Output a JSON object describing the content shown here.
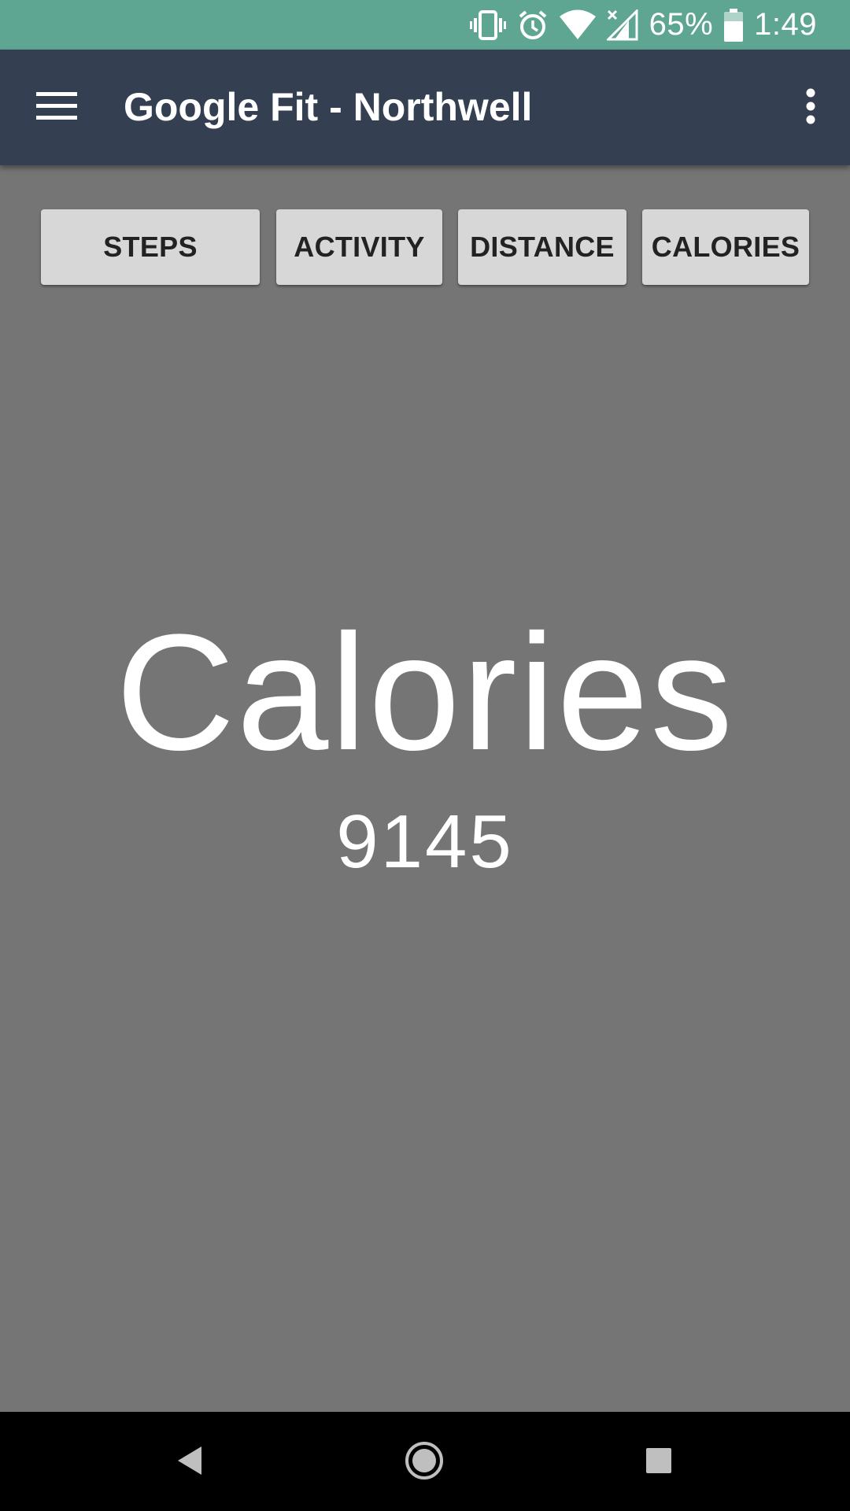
{
  "status_bar": {
    "battery_percent": "65%",
    "time": "1:49",
    "icons": [
      "vibrate-icon",
      "alarm-icon",
      "wifi-icon",
      "cell-signal-icon",
      "battery-icon"
    ],
    "color": "#5ea592"
  },
  "app_bar": {
    "title": "Google Fit - Northwell",
    "color": "#353f52",
    "icons": [
      "menu-icon",
      "overflow-menu-icon"
    ]
  },
  "tabs": [
    {
      "label": "STEPS"
    },
    {
      "label": "ACTIVITY"
    },
    {
      "label": "DISTANCE"
    },
    {
      "label": "CALORIES"
    }
  ],
  "main": {
    "metric_title": "Calories",
    "metric_value": "9145",
    "background": "#757575"
  },
  "nav_bar": {
    "icons": [
      "back-icon",
      "home-icon",
      "recents-icon"
    ]
  }
}
